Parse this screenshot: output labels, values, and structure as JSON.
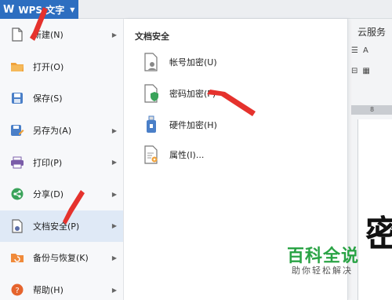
{
  "app": {
    "logo": "W",
    "title": "WPS 文字",
    "caret": "▼"
  },
  "menu": {
    "items": [
      {
        "label": "新建(N)",
        "icon": "new-doc-icon",
        "arrow": "▶"
      },
      {
        "label": "打开(O)",
        "icon": "folder-open-icon",
        "arrow": ""
      },
      {
        "label": "保存(S)",
        "icon": "save-icon",
        "arrow": ""
      },
      {
        "label": "另存为(A)",
        "icon": "save-as-icon",
        "arrow": "▶"
      },
      {
        "label": "打印(P)",
        "icon": "printer-icon",
        "arrow": "▶"
      },
      {
        "label": "分享(D)",
        "icon": "share-icon",
        "arrow": "▶"
      },
      {
        "label": "文档安全(P)",
        "icon": "document-security-icon",
        "arrow": "▶"
      },
      {
        "label": "备份与恢复(K)",
        "icon": "backup-restore-icon",
        "arrow": "▶"
      },
      {
        "label": "帮助(H)",
        "icon": "help-icon",
        "arrow": "▶"
      }
    ]
  },
  "submenu": {
    "title": "文档安全",
    "items": [
      {
        "label": "帐号加密(U)",
        "icon": "account-encrypt-icon"
      },
      {
        "label": "密码加密(P)",
        "icon": "password-encrypt-icon"
      },
      {
        "label": "硬件加密(H)",
        "icon": "hardware-encrypt-icon"
      },
      {
        "label": "属性(I)...",
        "icon": "properties-icon"
      }
    ]
  },
  "background": {
    "ribbon_tab": "云服务",
    "ribbon_row1": [
      "☰",
      "A"
    ],
    "ribbon_row2": [
      "⊟",
      "▦"
    ],
    "ruler_mark": "8",
    "doc_char": "密"
  },
  "watermark": {
    "main": "百科全说",
    "sub": "助你轻松解决"
  },
  "colors": {
    "accent": "#2d6ec0",
    "annotation": "#e5322d",
    "watermark": "#2aa345",
    "active_bg": "#dfe9f6"
  }
}
